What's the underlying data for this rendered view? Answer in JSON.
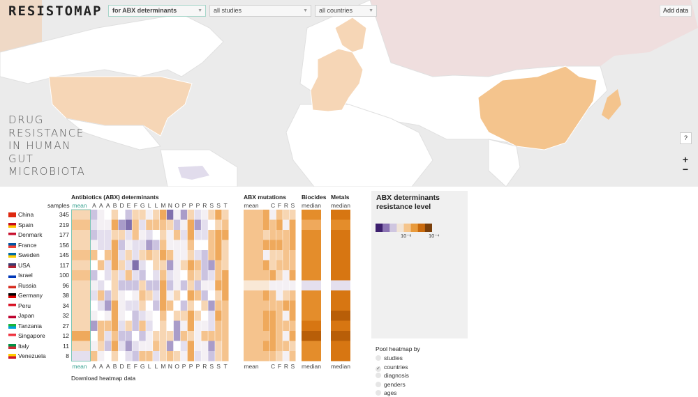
{
  "app": {
    "logo": "RESISTOMAP"
  },
  "filters": {
    "determinant": "for ABX determinants",
    "studies": "all studies",
    "countries": "all countries"
  },
  "add_data_label": "Add data",
  "tagline": [
    "DRUG",
    "RESISTANCE",
    "IN HUMAN",
    "GUT",
    "MICROBIOTA"
  ],
  "map_controls": {
    "help": "?",
    "zoom_in": "+",
    "zoom_out": "−"
  },
  "heatmap": {
    "headers": {
      "abx": "Antibiotics (ABX) determinants",
      "mutations": "ABX mutations",
      "biocides": "Biocides",
      "metals": "Metals",
      "samples": "samples"
    },
    "abx_columns": [
      "mean",
      "A",
      "A",
      "A",
      "B",
      "D",
      "E",
      "F",
      "G",
      "L",
      "L",
      "M",
      "N",
      "O",
      "P",
      "P",
      "P",
      "R",
      "S",
      "S",
      "T"
    ],
    "mutation_columns": [
      "mean",
      "",
      "C",
      "F",
      "R",
      "S"
    ],
    "biocides_columns": [
      "median"
    ],
    "metals_columns": [
      "median"
    ],
    "rows": [
      {
        "country": "China",
        "samples": "345",
        "flag": "cn"
      },
      {
        "country": "Spain",
        "samples": "219",
        "flag": "es"
      },
      {
        "country": "Denmark",
        "samples": "177",
        "flag": "dk"
      },
      {
        "country": "France",
        "samples": "156",
        "flag": "fr"
      },
      {
        "country": "Sweden",
        "samples": "145",
        "flag": "se"
      },
      {
        "country": "USA",
        "samples": "117",
        "flag": "us"
      },
      {
        "country": "Israel",
        "samples": "100",
        "flag": "il"
      },
      {
        "country": "Russia",
        "samples": "96",
        "flag": "ru"
      },
      {
        "country": "Germany",
        "samples": "38",
        "flag": "de"
      },
      {
        "country": "Peru",
        "samples": "34",
        "flag": "pe"
      },
      {
        "country": "Japan",
        "samples": "32",
        "flag": "jp"
      },
      {
        "country": "Tanzania",
        "samples": "27",
        "flag": "tz"
      },
      {
        "country": "Singapore",
        "samples": "12",
        "flag": "sg"
      },
      {
        "country": "Italy",
        "samples": "11",
        "flag": "it"
      },
      {
        "country": "Venezuela",
        "samples": "8",
        "flag": "ve"
      }
    ],
    "download_label": "Download heatmap data"
  },
  "legend": {
    "title": "ABX determinants resistance level",
    "tick_low": "10⁻⁸",
    "tick_high": "10⁻⁴",
    "colors": [
      "#3d1f6e",
      "#8c74b4",
      "#cfc6e0",
      "#f1e4d6",
      "#f5c58c",
      "#e89a3c",
      "#c96a0d",
      "#7a3f0a"
    ]
  },
  "pool": {
    "title": "Pool heatmap by",
    "options": [
      {
        "label": "studies",
        "checked": false
      },
      {
        "label": "countries",
        "checked": true
      },
      {
        "label": "diagnosis",
        "checked": false
      },
      {
        "label": "genders",
        "checked": false
      },
      {
        "label": "ages",
        "checked": false
      }
    ]
  },
  "highlighted_countries": [
    "USA",
    "Spain",
    "France",
    "Italy",
    "Germany",
    "Denmark",
    "Sweden",
    "China",
    "Japan"
  ]
}
